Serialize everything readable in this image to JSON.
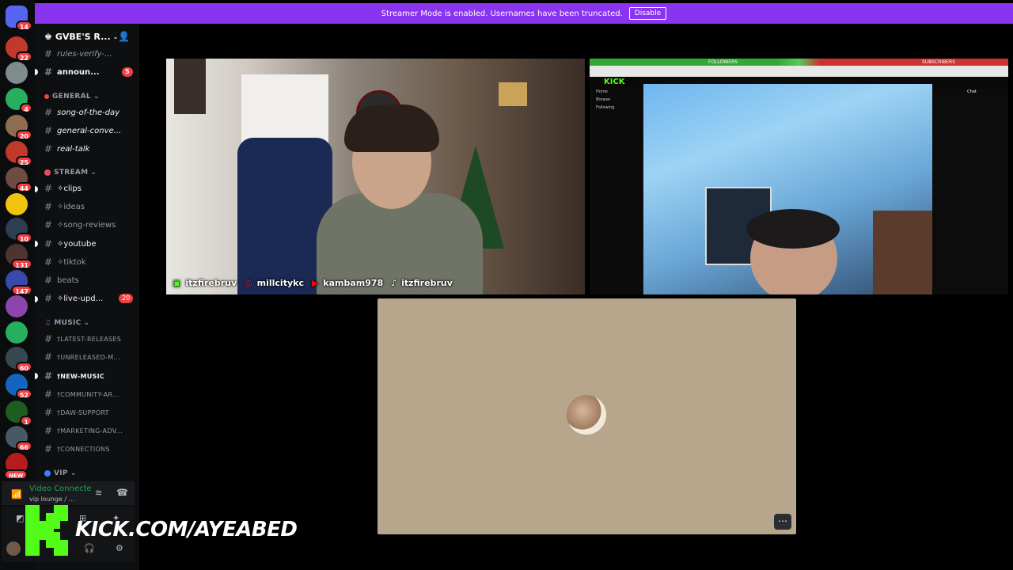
{
  "banner": {
    "text": "Streamer Mode is enabled. Usernames have been truncated.",
    "button": "Disable"
  },
  "server_rail": [
    {
      "badge": "14",
      "color": "#5865f2"
    },
    {
      "badge": "22",
      "color": "#c0392b"
    },
    {
      "badge": "",
      "color": "#7f8c8d"
    },
    {
      "badge": "4",
      "color": "#27ae60"
    },
    {
      "badge": "20",
      "color": "#8e6e53"
    },
    {
      "badge": "25",
      "color": "#c0392b"
    },
    {
      "badge": "44",
      "color": "#6d4c41"
    },
    {
      "badge": "",
      "color": "#f1c40f"
    },
    {
      "badge": "10",
      "color": "#2c3e50"
    },
    {
      "badge": "131",
      "color": "#4e342e"
    },
    {
      "badge": "147",
      "color": "#3949ab"
    },
    {
      "badge": "",
      "color": "#8e44ad"
    },
    {
      "badge": "",
      "color": "#27ae60"
    },
    {
      "badge": "60",
      "color": "#37474f"
    },
    {
      "badge": "52",
      "color": "#1565c0"
    },
    {
      "badge": "1",
      "color": "#1b5e20"
    },
    {
      "badge": "66",
      "color": "#455a64"
    },
    {
      "badge": "NEW",
      "color": "#b71c1c"
    }
  ],
  "sidebar": {
    "server_name": "GVBE'S R...",
    "channels_top": [
      {
        "name": "rules-verify-...",
        "style": "muted"
      },
      {
        "name": "announ...",
        "style": "bright",
        "count": "5"
      }
    ],
    "general": {
      "label": "GENERAL",
      "channels": [
        {
          "name": "song-of-the-day"
        },
        {
          "name": "general-conve..."
        },
        {
          "name": "real-talk"
        }
      ]
    },
    "stream": {
      "label": "STREAM",
      "channels": [
        {
          "name": "✧clips",
          "style": "bright"
        },
        {
          "name": "✧ideas",
          "style": "muted"
        },
        {
          "name": "✧song-reviews",
          "style": "muted"
        },
        {
          "name": "✧youtube",
          "style": "bright"
        },
        {
          "name": "✧tiktok",
          "style": "muted"
        },
        {
          "name": "beats",
          "style": "muted"
        },
        {
          "name": "✧live-upd...",
          "style": "bright",
          "count": "20"
        }
      ]
    },
    "music": {
      "label": "MUSIC",
      "channels": [
        {
          "name": "†LATEST-RELEASES",
          "style": "muted"
        },
        {
          "name": "†UNRELEASED-M...",
          "style": "muted"
        },
        {
          "name": "†NEW-MUSIC",
          "style": "bright"
        },
        {
          "name": "†COMMUNITY-AR...",
          "style": "muted"
        },
        {
          "name": "†DAW-SUPPORT",
          "style": "muted"
        },
        {
          "name": "†MARKETING-ADV...",
          "style": "muted"
        },
        {
          "name": "†CONNECTIONS",
          "style": "muted"
        }
      ]
    },
    "vip": {
      "label": "VIP"
    }
  },
  "voice": {
    "status": "Video Connecte",
    "channel": "vip lounge / ..."
  },
  "overlay": {
    "url": "KICK.COM/AYEABED"
  },
  "tiles": {
    "socials": [
      "itzfirebruv",
      "millcitykc",
      "kambam978",
      "itzfirebruv"
    ],
    "kick_browser": {
      "logo": "KICK",
      "nav": [
        "Home",
        "Browse",
        "Following"
      ],
      "followers_label": "FOLLOWERS",
      "subscribers_label": "SUBSCRIBERS",
      "chat_label": "Chat"
    }
  }
}
